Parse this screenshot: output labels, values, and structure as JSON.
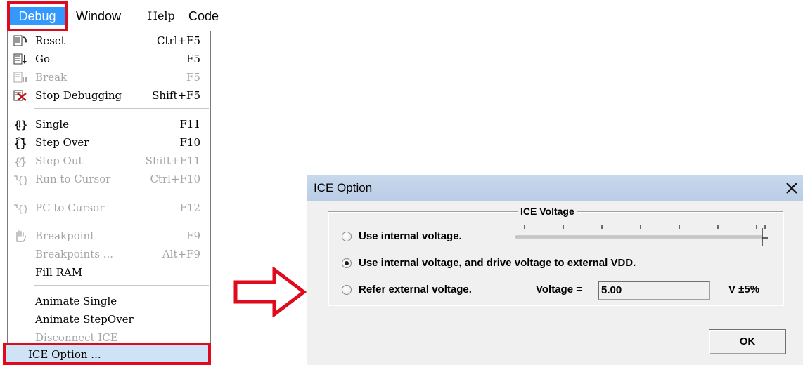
{
  "menubar": {
    "debug": "Debug",
    "window": "Window",
    "help": "Help",
    "code": "Code"
  },
  "menu": {
    "reset": {
      "label": "Reset",
      "shortcut": "Ctrl+F5"
    },
    "go": {
      "label": "Go",
      "shortcut": "F5"
    },
    "break": {
      "label": "Break",
      "shortcut": "F5"
    },
    "stop": {
      "label": "Stop Debugging",
      "shortcut": "Shift+F5"
    },
    "single": {
      "label": "Single",
      "shortcut": "F11"
    },
    "step_over": {
      "label": "Step Over",
      "shortcut": "F10"
    },
    "step_out": {
      "label": "Step Out",
      "shortcut": "Shift+F11"
    },
    "run_to_cursor": {
      "label": "Run to Cursor",
      "shortcut": "Ctrl+F10"
    },
    "pc_to_cursor": {
      "label": "PC to Cursor",
      "shortcut": "F12"
    },
    "breakpoint": {
      "label": "Breakpoint",
      "shortcut": "F9"
    },
    "breakpoints": {
      "label": "Breakpoints ...",
      "shortcut": "Alt+F9"
    },
    "fill_ram": {
      "label": "Fill RAM"
    },
    "animate_single": {
      "label": "Animate Single"
    },
    "animate_stepover": {
      "label": "Animate StepOver"
    },
    "disconnect_ice": {
      "label": "Disconnect ICE"
    },
    "ice_option": {
      "label": "ICE Option ..."
    }
  },
  "dialog": {
    "title": "ICE Option",
    "group_title": "ICE Voltage",
    "opt_internal": "Use internal voltage.",
    "opt_internal_drive": "Use internal voltage, and drive voltage to external VDD.",
    "opt_external": "Refer external voltage.",
    "selected_option": "opt_internal_drive",
    "voltage_label": "Voltage =",
    "voltage_value": "5.00",
    "voltage_unit": "V  ±5%",
    "ok": "OK"
  },
  "colors": {
    "highlight_red": "#e00a1e",
    "menu_selected": "#3399ff",
    "menu_hover": "#cfe3f6",
    "disabled_text": "#a5a5a5"
  },
  "icons": {
    "reset": "reset-icon",
    "go": "go-icon",
    "break": "break-icon",
    "stop": "stop-debugging-icon",
    "single": "single-step-icon",
    "step_over": "step-over-icon",
    "step_out": "step-out-icon",
    "run_to_cursor": "run-to-cursor-icon",
    "pc_to_cursor": "pc-to-cursor-icon",
    "breakpoint": "hand-icon",
    "arrow": "arrow-right-icon",
    "close": "close-icon"
  }
}
